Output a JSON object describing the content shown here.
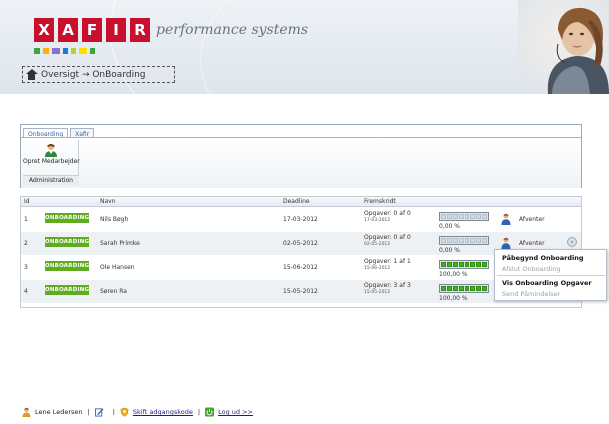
{
  "header": {
    "logo_letters": [
      "X",
      "A",
      "F",
      "I",
      "R"
    ],
    "tagline": "performance systems",
    "brand_color": "#c8102e",
    "colorbar": [
      "#3aa642",
      "#ffb000",
      "#8b6fd1",
      "#1d7bd1",
      "#b1d33a",
      "#ffde00",
      "#3aa642"
    ]
  },
  "breadcrumb": {
    "icon": "home-icon",
    "text": "Oversigt → OnBoarding"
  },
  "tabs": [
    {
      "label": "Onboarding",
      "active": true
    },
    {
      "label": "Xafir",
      "active": false
    }
  ],
  "ribbon": {
    "button_label": "Opret Medarbejder",
    "button_icon": "person-add-icon",
    "group_label": "Administration"
  },
  "grid": {
    "columns": [
      "Id",
      "Navn",
      "Deadline",
      "Fremskridt"
    ],
    "rows": [
      {
        "id": "1",
        "badge": "ONBOARDING",
        "name": "Nils Bøgh",
        "deadline": "17-03-2012",
        "progress_text": "Opgaver: 0 af 0",
        "progress_date": "17-03-2012",
        "progress_fraction": 0,
        "percent": "0,00 %",
        "status": "Afventer"
      },
      {
        "id": "2",
        "badge": "ONBOARDING",
        "name": "Sarah Primke",
        "deadline": "02-05-2012",
        "progress_text": "Opgaver: 0 af 0",
        "progress_date": "02-05-2012",
        "progress_fraction": 0,
        "percent": "0,00 %",
        "status": "Afventer"
      },
      {
        "id": "3",
        "badge": "ONBOARDING",
        "name": "Ole Hansen",
        "deadline": "15-06-2012",
        "progress_text": "Opgaver: 1 af 1",
        "progress_date": "15-06-2012",
        "progress_fraction": 1,
        "percent": "100,00 %",
        "status": ""
      },
      {
        "id": "4",
        "badge": "ONBOARDING",
        "name": "Søren Ra",
        "deadline": "15-05-2012",
        "progress_text": "Opgaver: 3 af 3",
        "progress_date": "15-05-2012",
        "progress_fraction": 1,
        "percent": "100,00 %",
        "status": ""
      }
    ],
    "badge_color": "#5fad1f",
    "progress_color": "#44b21e"
  },
  "context_menu": {
    "items": [
      {
        "label": "Påbegynd Onboarding",
        "enabled": true
      },
      {
        "label": "Afslut Onboarding",
        "enabled": false
      },
      {
        "label": "Vis Onboarding Opgaver",
        "enabled": true
      },
      {
        "label": "Send Påmindelser",
        "enabled": false
      }
    ]
  },
  "footer": {
    "user_name": "Lene Ledersen",
    "sep": "|",
    "change_password": "Skift adgangskode",
    "logout": "Log ud >>"
  }
}
